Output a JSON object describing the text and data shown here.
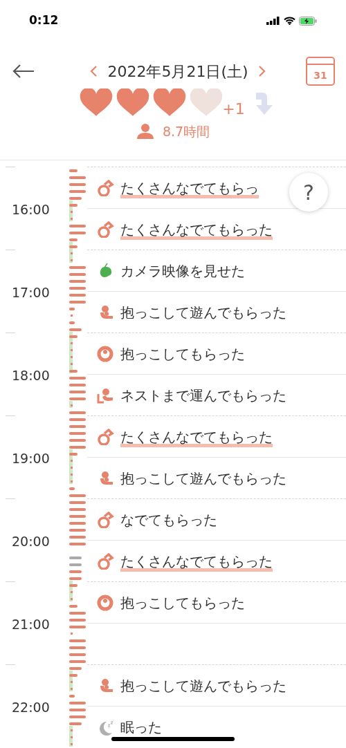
{
  "status_bar": {
    "time": "0:12"
  },
  "header": {
    "date": "2022年5月21日(土)",
    "calendar_day": "31",
    "hearts": {
      "stars": 3
    },
    "extra": "+1",
    "sleep": "8.7時間"
  },
  "hour_labels": [
    "16:00",
    "17:00",
    "18:00",
    "19:00",
    "20:00",
    "21:00",
    "22:00"
  ],
  "help_button": {
    "label": "?"
  },
  "rows": [
    {
      "kind": "pet",
      "text": "たくさんなでてもらっ",
      "highlighted": true
    },
    {
      "kind": "pet",
      "text": "たくさんなでてもらった",
      "highlighted": true
    },
    {
      "kind": "camera",
      "text": "カメラ映像を見せた",
      "highlighted": false
    },
    {
      "kind": "play-hold",
      "text": "抱っこして遊んでもらった",
      "highlighted": false
    },
    {
      "kind": "hold",
      "text": "抱っこしてもらった",
      "highlighted": false
    },
    {
      "kind": "carry",
      "text": "ネストまで運んでもらった",
      "highlighted": false
    },
    {
      "kind": "pet",
      "text": "たくさんなでてもらった",
      "highlighted": true
    },
    {
      "kind": "play-hold",
      "text": "抱っこして遊んでもらった",
      "highlighted": false
    },
    {
      "kind": "pet",
      "text": "なでてもらった",
      "highlighted": false
    },
    {
      "kind": "pet",
      "text": "たくさんなでてもらった",
      "highlighted": true
    },
    {
      "kind": "hold",
      "text": "抱っこしてもらった",
      "highlighted": false
    },
    {
      "kind": "empty"
    },
    {
      "kind": "play-hold",
      "text": "抱っこして遊んでもらった",
      "highlighted": false
    },
    {
      "kind": "sleep",
      "text": "眠った",
      "highlighted": false
    }
  ]
}
